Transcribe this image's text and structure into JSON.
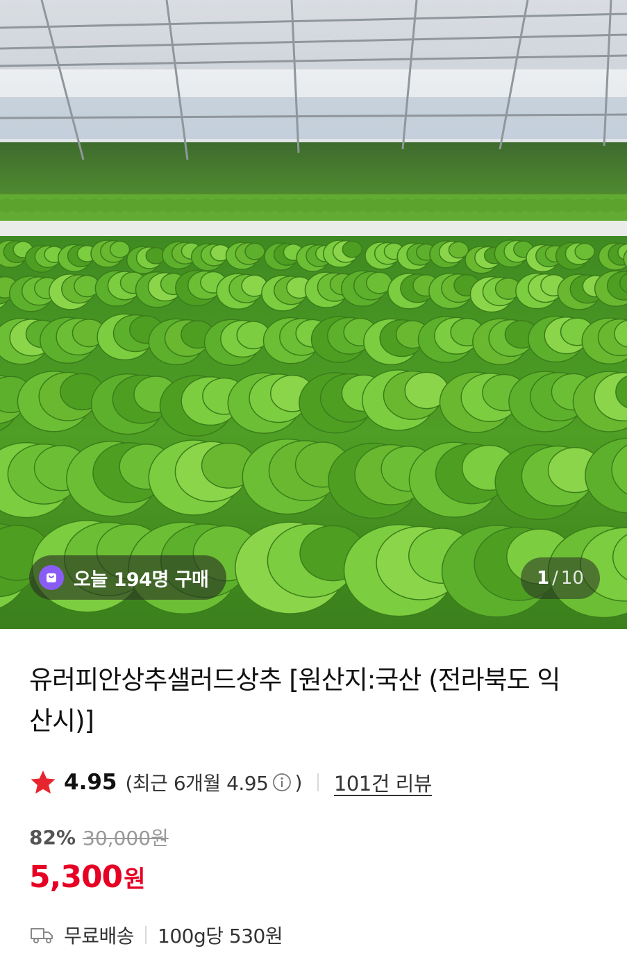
{
  "hero": {
    "image_alt": "greenhouse lettuce field photo",
    "buyers_badge": "오늘 194명 구매",
    "buyers_icon": "shopping-bag-icon",
    "badge_icon_color": "#8a5cf6",
    "counter_current": "1",
    "counter_sep": "/",
    "counter_total": "10"
  },
  "product": {
    "title": "유러피안상추샐러드상추 [원산지:국산 (전라북도 익산시)]",
    "rating": "4.95",
    "recent_prefix": "(최근 6개월 4.95",
    "recent_suffix": ")",
    "review_count": "101건 리뷰",
    "discount": "82%",
    "original_price": "30,000원",
    "price": "5,300",
    "currency": "원",
    "shipping": "무료배송",
    "unit_price": "100g당 530원"
  },
  "colors": {
    "accent_red": "#e60023",
    "star": "#e8252e"
  }
}
